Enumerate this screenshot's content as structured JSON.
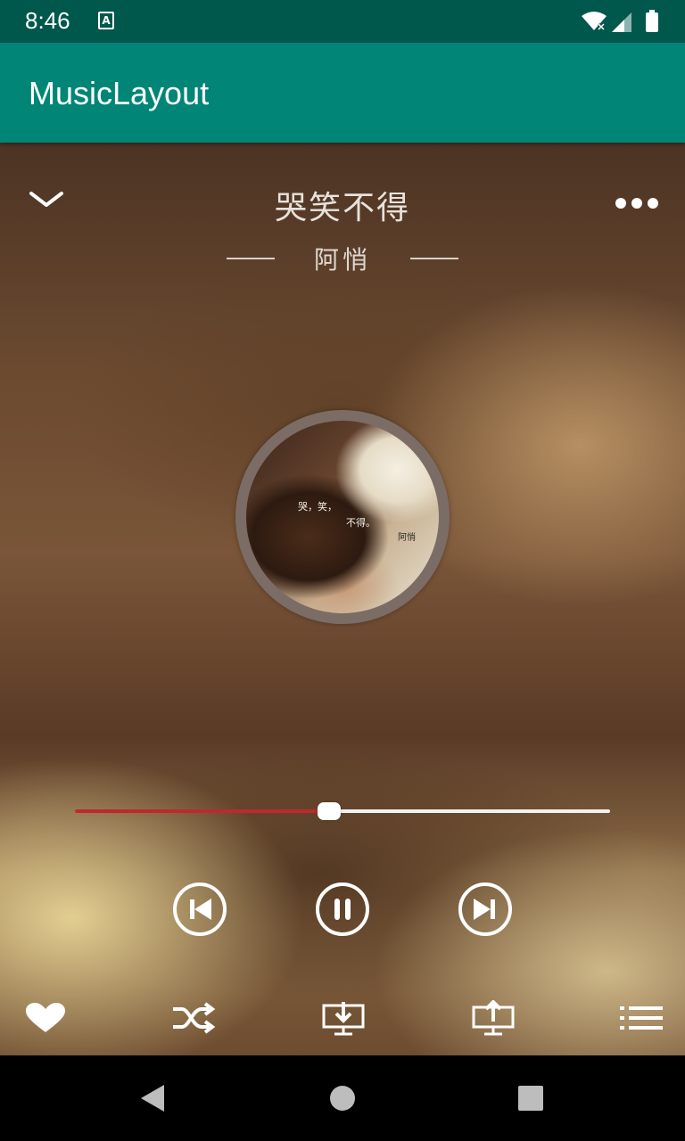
{
  "status_bar": {
    "time": "8:46",
    "notification_icon": "text-a-icon",
    "icons": [
      "wifi-icon",
      "cell-signal-icon",
      "battery-icon"
    ]
  },
  "app_bar": {
    "title": "MusicLayout"
  },
  "player": {
    "song_title": "哭笑不得",
    "artist": "阿悄",
    "album_text_line1": "哭，笑，",
    "album_text_line2": "不得。",
    "album_text_artist": "阿悄",
    "progress": 0.475,
    "colors": {
      "progress_played": "#c0282d",
      "progress_remaining": "#f2f2f2",
      "app_bar": "#008577",
      "status_bar": "#00574b"
    },
    "header_icons": [
      "chevron-down-icon",
      "more-icon"
    ],
    "playback_icons": [
      "previous-icon",
      "pause-icon",
      "next-icon"
    ],
    "action_icons": [
      "heart-icon",
      "shuffle-icon",
      "download-icon",
      "upload-icon",
      "playlist-icon"
    ]
  },
  "nav_bar": {
    "icons": [
      "back-icon",
      "home-icon",
      "recents-icon"
    ]
  }
}
